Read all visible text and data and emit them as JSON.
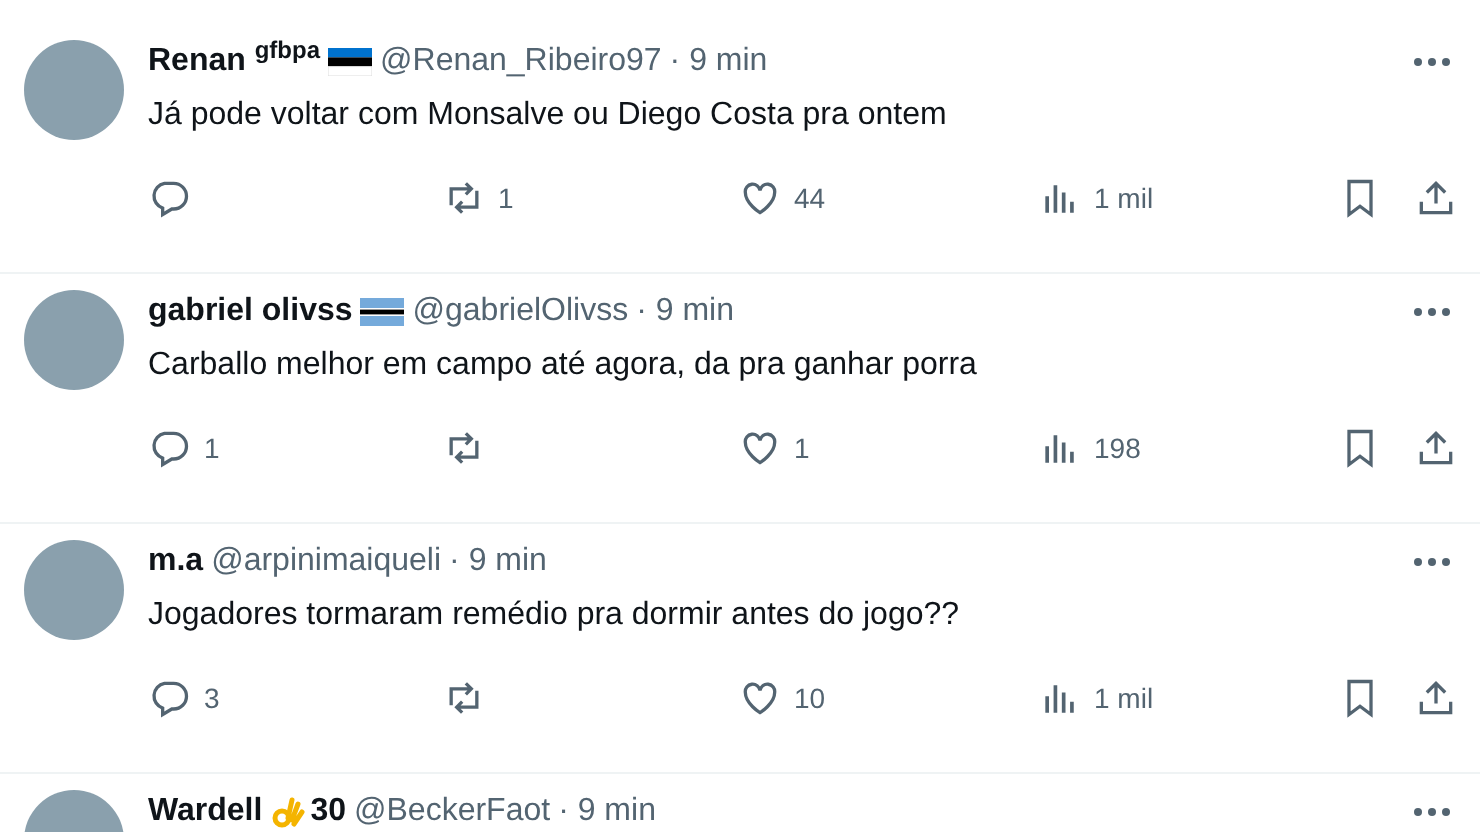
{
  "posts": [
    {
      "name": "Renan $^{gfbpa}$",
      "badge": {
        "kind": "estonia-flag"
      },
      "handle": "@Renan_Ribeiro97",
      "time": "· 9 min",
      "text": "Já pode voltar com Monsalve ou Diego Costa pra ontem",
      "reposts": "1",
      "likes": "44",
      "views": "1 mil"
    },
    {
      "name": "gabriel olivss",
      "badge": {
        "kind": "botswana-flag"
      },
      "handle": "@gabrielOlivss",
      "time": "· 9 min",
      "text": "Carballo melhor em campo até agora, da pra ganhar porra",
      "replies": "1",
      "likes": "1",
      "views": "198"
    },
    {
      "name": "m.a",
      "handle": "@arpinimaiqueli",
      "time": "· 9 min",
      "text": "Jogadores tormaram remédio pra dormir antes do jogo??",
      "replies": "3",
      "likes": "10",
      "views": "1 mil"
    },
    {
      "name": "Wardell",
      "badge": {
        "kind": "ok-hand",
        "text": "30"
      },
      "handle": "@BeckerFaot",
      "time": "· 9 min"
    }
  ]
}
